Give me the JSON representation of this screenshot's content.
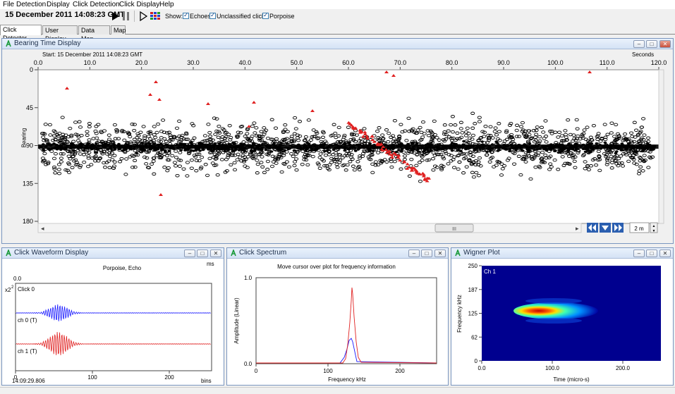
{
  "menu": [
    "File",
    "Detection",
    "Display",
    "Click Detection",
    "Click Display",
    "Help"
  ],
  "toolbar": {
    "datetime": "15 December 2011 14:08:23 GMT",
    "show_label": "Show:",
    "echoes_label": "Echoes",
    "unclassified_label": "Unclassified clicks",
    "porpoise_label": "Porpoise"
  },
  "tabs": [
    "Click Detector",
    "User Display",
    "Data Map",
    "Map"
  ],
  "btd": {
    "title": "Bearing Time Display",
    "start": "Start: 15 December 2011 14:08:23 GMT",
    "seconds_label": "Seconds",
    "x_ticks": [
      "0.0",
      "10.0",
      "20.0",
      "30.0",
      "40.0",
      "50.0",
      "60.0",
      "70.0",
      "80.0",
      "90.0",
      "100.0",
      "110.0",
      "120.0"
    ],
    "y_label": "Bearing",
    "y_ticks": [
      "0",
      "45",
      "90",
      "135",
      "180"
    ],
    "scroll_thumb": "III",
    "time_span": "2 m"
  },
  "waveform": {
    "title": "Click Waveform Display",
    "subtitle": "Porpoise, Echo",
    "unit": "ms",
    "scale": "x2",
    "scale_exp": "2",
    "x0": "0.0",
    "click_label": "Click 0",
    "ch0_label": "ch 0 (T)",
    "ch1_label": "ch 1 (T)",
    "x_ticks": [
      "0",
      "100",
      "200"
    ],
    "time": "14:09:29.806",
    "bins": "bins"
  },
  "spectrum": {
    "title": "Click Spectrum",
    "hint": "Move cursor over plot for frequency information",
    "y_top": "1.0",
    "y_bottom": "0.0",
    "y_label": "Amplitude (Linear)",
    "x_ticks": [
      "0",
      "100",
      "200"
    ],
    "x_label": "Frequency kHz"
  },
  "wigner": {
    "title": "Wigner Plot",
    "channel": "Ch 1",
    "y_ticks": [
      "250",
      "187",
      "125",
      "62",
      "0"
    ],
    "y_label": "Frequency kHz",
    "x_ticks": [
      "0.0",
      "100.0",
      "200.0"
    ],
    "x_label": "Time (micro-s)"
  },
  "colors": {
    "porpoise": "#e02020",
    "ch0": "#1a1aff",
    "ch1": "#e02020",
    "accent": "#2b5fb0"
  }
}
